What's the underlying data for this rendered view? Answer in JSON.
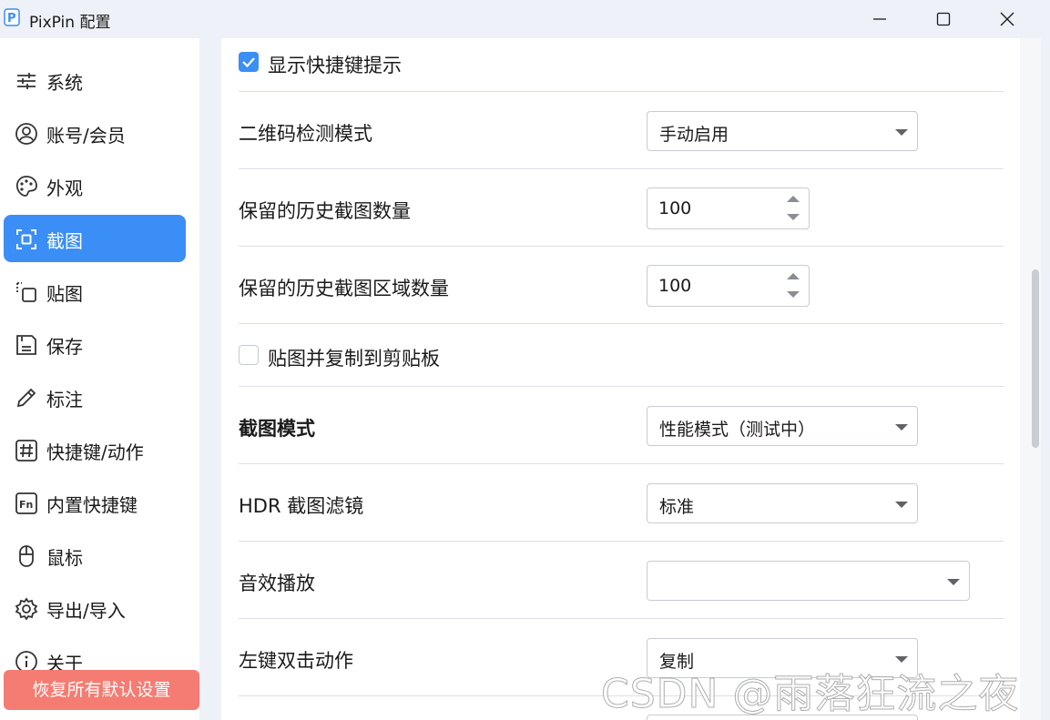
{
  "window": {
    "title": "PixPin 配置"
  },
  "sidebar": {
    "items": [
      {
        "label": "系统",
        "icon": "sliders-icon"
      },
      {
        "label": "账号/会员",
        "icon": "user-icon"
      },
      {
        "label": "外观",
        "icon": "palette-icon"
      },
      {
        "label": "截图",
        "icon": "screenshot-icon",
        "active": true
      },
      {
        "label": "贴图",
        "icon": "pin-icon"
      },
      {
        "label": "保存",
        "icon": "save-icon"
      },
      {
        "label": "标注",
        "icon": "pencil-icon"
      },
      {
        "label": "快捷键/动作",
        "icon": "hash-icon"
      },
      {
        "label": "内置快捷键",
        "icon": "fn-key-icon"
      },
      {
        "label": "鼠标",
        "icon": "mouse-icon"
      },
      {
        "label": "导出/导入",
        "icon": "gear-icon"
      },
      {
        "label": "关于",
        "icon": "info-icon"
      }
    ],
    "reset_label": "恢复所有默认设置"
  },
  "settings": {
    "show_shortcut_hint": {
      "label": "显示快捷键提示",
      "checked": true
    },
    "qr_mode": {
      "label": "二维码检测模式",
      "value": "手动启用"
    },
    "history_count": {
      "label": "保留的历史截图数量",
      "value": "100"
    },
    "history_region_count": {
      "label": "保留的历史截图区域数量",
      "value": "100"
    },
    "pin_copy": {
      "label": "贴图并复制到剪贴板",
      "checked": false
    },
    "capture_mode": {
      "label": "截图模式",
      "value": "性能模式（测试中）"
    },
    "hdr_filter": {
      "label": "HDR 截图滤镜",
      "value": "标准"
    },
    "sound": {
      "label": "音效播放",
      "value": ""
    },
    "double_click": {
      "label": "左键双击动作",
      "value": "复制"
    }
  },
  "watermark": "CSDN @雨落狂流之夜",
  "colors": {
    "accent": "#3b8ef5",
    "reset": "#f47c72"
  }
}
